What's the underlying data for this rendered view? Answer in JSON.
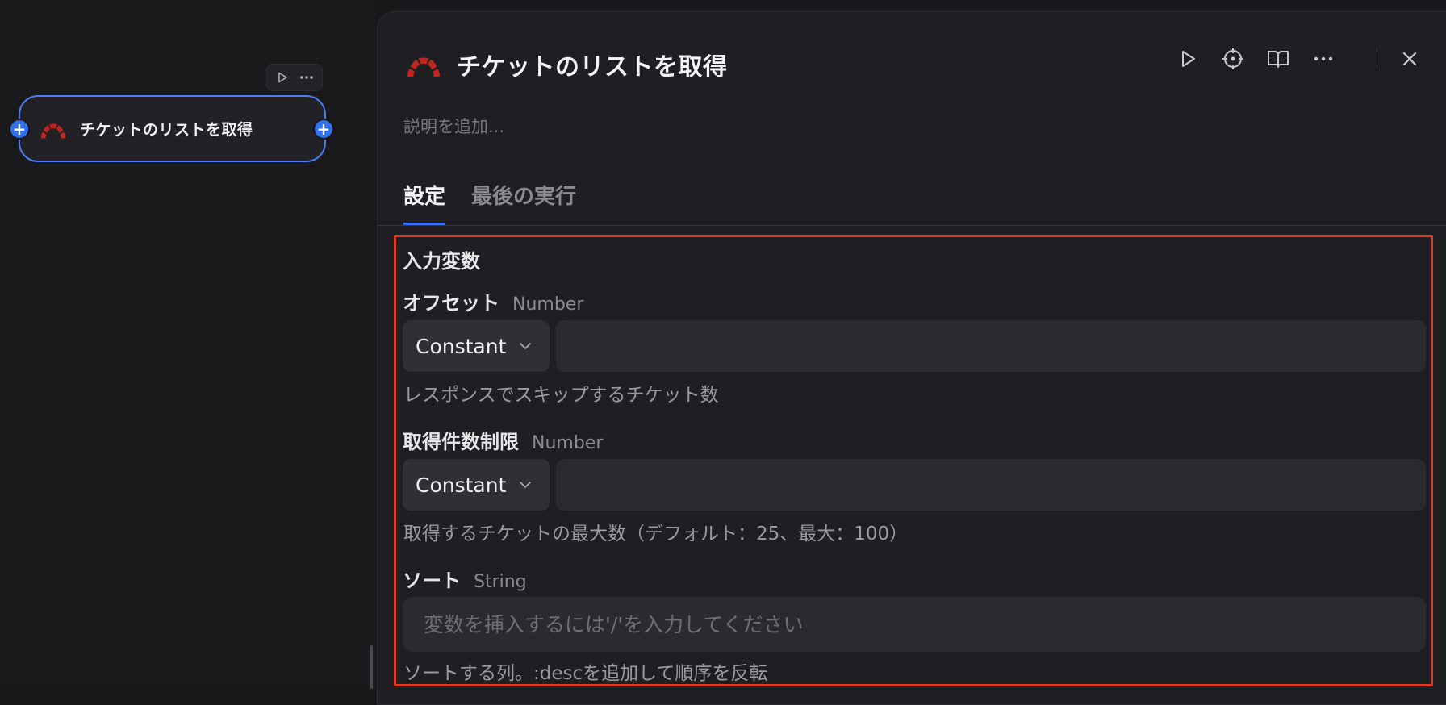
{
  "canvas": {
    "node": {
      "title": "チケットのリストを取得",
      "logo": "redmine-logo"
    }
  },
  "panel": {
    "title": "チケットのリストを取得",
    "description_placeholder": "説明を追加...",
    "header_icons": [
      "play-icon",
      "crosshair-icon",
      "book-icon",
      "more-icon",
      "close-icon"
    ],
    "tabs": [
      {
        "label": "設定",
        "active": true
      },
      {
        "label": "最後の実行",
        "active": false
      }
    ],
    "section_title": "入力変数",
    "fields": [
      {
        "name": "オフセット",
        "type": "Number",
        "mode": "Constant",
        "value": "",
        "help": "レスポンスでスキップするチケット数"
      },
      {
        "name": "取得件数制限",
        "type": "Number",
        "mode": "Constant",
        "value": "",
        "help": "取得するチケットの最大数（デフォルト：25、最大：100）"
      },
      {
        "name": "ソート",
        "type": "String",
        "placeholder": "変数を挿入するには'/'を入力してください",
        "help": "ソートする列。:descを追加して順序を反転"
      }
    ]
  },
  "colors": {
    "accent": "#3b6ff2",
    "highlight": "#e23a1e",
    "logo_red": "#c0261c"
  }
}
